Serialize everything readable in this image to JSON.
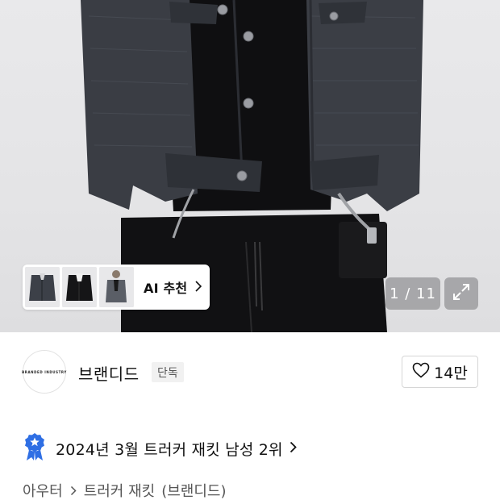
{
  "hero": {
    "image_alt": "",
    "counter": "1 / 11",
    "ai_recommend": {
      "label": "AI 추천",
      "thumbnails": [
        "denim-jacket-thumb",
        "black-jacket-thumb",
        "model-thumb"
      ]
    },
    "expand_icon": "expand-icon"
  },
  "brand": {
    "name": "브랜디드",
    "logo_text": "BRANDED INDUSTRY",
    "badge": "단독",
    "like_count": "14만",
    "like_icon": "heart-icon"
  },
  "ranking": {
    "icon": "ranking-badge-icon",
    "text": "2024년 3월 트러커 재킷 남성 2위"
  },
  "breadcrumb": {
    "items": [
      "아우터",
      "트러커 재킷"
    ],
    "brand": "(브랜디드)"
  },
  "colors": {
    "accent_blue": "#2f6fe4",
    "text_primary": "#111111",
    "text_secondary": "#555555",
    "overlay": "#78787c"
  }
}
